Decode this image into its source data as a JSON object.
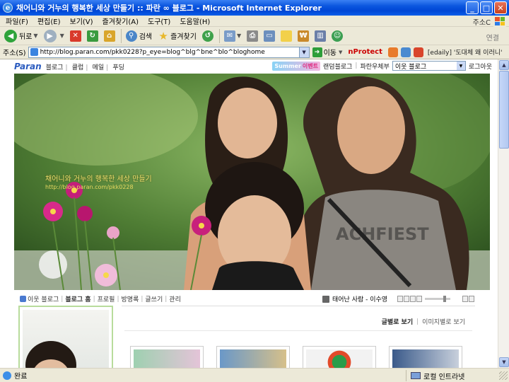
{
  "window": {
    "title": "채어니와 거누의 행복한 세상 만들기 :: 파란 ∞ 블로그 - Microsoft Internet Explorer",
    "buttons": {
      "minimize": "_",
      "maximize": "□",
      "close": "✕"
    }
  },
  "menu": {
    "items": [
      "파일(F)",
      "편집(E)",
      "보기(V)",
      "즐겨찾기(A)",
      "도구(T)",
      "도움말(H)"
    ],
    "right_label": "주소C"
  },
  "toolbar": {
    "back_label": "뒤로",
    "search_label": "검색",
    "favorites_label": "즐겨찾기",
    "links_label": "연결"
  },
  "address": {
    "label": "주소(S)",
    "url": "http://blog.paran.com/pkk0228?p_eye=blog^blg^bne^blo^bloghome",
    "go_label": "이동",
    "nprotect": "nProtect",
    "news_ticker": "[edaily] '도대체 왜 이러니'"
  },
  "blog_header": {
    "logo": "Paran",
    "nav": [
      "블로그",
      "클럽",
      "메일",
      "푸딩"
    ],
    "summer_event": "Summer",
    "summer_event_suffix": "이벤트",
    "random_blog": "랜덤블로그",
    "paran_news": "파란우체부",
    "neighbor_select": "이웃 블로그",
    "logout": "로그아웃"
  },
  "banner": {
    "title": "채어니와 거누의 행복한 세상 만들기",
    "url": "http://blog.paran.com/pkk0228"
  },
  "blog_nav": {
    "items": [
      "이웃 블로그",
      "블로그 홈",
      "프로필",
      "방명록",
      "글쓰기",
      "관리"
    ],
    "active_index": 1
  },
  "music": {
    "now_playing": "태어난 사람 - 이수영"
  },
  "post_view": {
    "tab_post": "글별로 보기",
    "tab_image": "이미지별로 보기"
  },
  "status": {
    "text": "완료",
    "zone": "로컬 인트라넷"
  },
  "colors": {
    "titlebar": "#0a55de",
    "chrome": "#ece9d8",
    "profile_border": "#b8dc9c"
  }
}
